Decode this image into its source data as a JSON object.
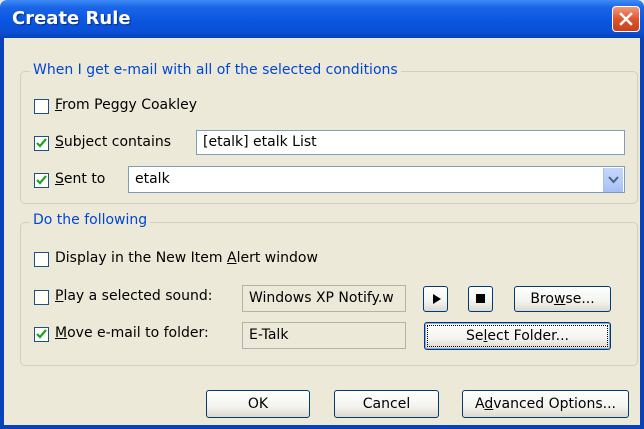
{
  "window": {
    "title": "Create Rule"
  },
  "conditions": {
    "legend": "When I get e-mail with all of the selected conditions",
    "from": {
      "label_key": "F",
      "label_rest": "rom Peggy Coakley",
      "checked": false
    },
    "subject": {
      "label_key": "S",
      "label_rest": "ubject contains",
      "checked": true,
      "value": "[etalk] etalk List"
    },
    "sent_to": {
      "label_key": "S",
      "label_rest": "ent to",
      "checked": true,
      "value": "etalk"
    }
  },
  "actions": {
    "legend": "Do the following",
    "alert": {
      "label_pre": "Display in the New Item ",
      "label_key": "A",
      "label_rest": "lert window",
      "checked": false
    },
    "sound": {
      "label_key": "P",
      "label_rest": "lay a selected sound:",
      "checked": false,
      "value": "Windows XP Notify.w",
      "browse_pre": "Bro",
      "browse_key": "w",
      "browse_rest": "se..."
    },
    "move": {
      "label_key": "M",
      "label_rest": "ove e-mail to folder:",
      "checked": true,
      "value": "E-Talk",
      "select_pre": "Se",
      "select_key": "l",
      "select_rest": "ect Folder..."
    }
  },
  "buttons": {
    "ok": "OK",
    "cancel": "Cancel",
    "advanced_pre": "A",
    "advanced_key": "d",
    "advanced_rest": "vanced Options..."
  },
  "colors": {
    "title_bar": "#0a56e0",
    "legend_text": "#0046d5",
    "dialog_bg": "#ece9d8",
    "close_button": "#e0542d"
  }
}
